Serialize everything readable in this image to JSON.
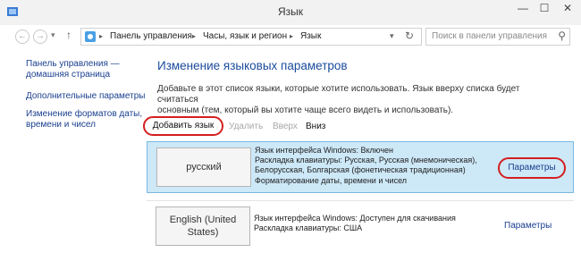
{
  "window": {
    "title": "Язык",
    "minimize_glyph": "—",
    "maximize_glyph": "☐",
    "close_glyph": "✕"
  },
  "nav": {
    "back_glyph": "←",
    "forward_glyph": "→",
    "dropdown_glyph": "▾",
    "up_glyph": "↑",
    "refresh_glyph": "↻",
    "search_glyph": "⚲"
  },
  "breadcrumb": [
    "Панель управления",
    "Часы, язык и регион",
    "Язык"
  ],
  "breadcrumb_sep": "▸",
  "search": {
    "placeholder": "Поиск в панели управления"
  },
  "left_nav": {
    "home": [
      "Панель управления —",
      "домашняя страница"
    ],
    "advanced": "Дополнительные параметры",
    "formats": [
      "Изменение форматов даты,",
      "времени и чисел"
    ]
  },
  "main": {
    "heading": "Изменение языковых параметров",
    "description": [
      "Добавьте в этот список языки, которые хотите использовать. Язык вверху списка будет считаться",
      "основным (тем, который вы хотите чаще всего видеть и использовать)."
    ]
  },
  "toolbar": {
    "add": "Добавить язык",
    "remove": "Удалить",
    "up": "Вверх",
    "down": "Вниз"
  },
  "languages": [
    {
      "name": "русский",
      "info": [
        "Язык интерфейса Windows: Включен",
        "Раскладка клавиатуры: Русская, Русская (мнемоническая),",
        "Белорусская, Болгарская (фонетическая традиционная)",
        "Форматирование даты, времени и чисел"
      ],
      "options": "Параметры"
    },
    {
      "name": [
        "English (United",
        "States)"
      ],
      "info": [
        "Язык интерфейса Windows: Доступен для скачивания",
        "Раскладка клавиатуры: США"
      ],
      "options": "Параметры"
    }
  ],
  "colors": {
    "accent": "#1a4b9c",
    "highlight": "#d31f1f",
    "selected_row": "#cde8f7"
  }
}
